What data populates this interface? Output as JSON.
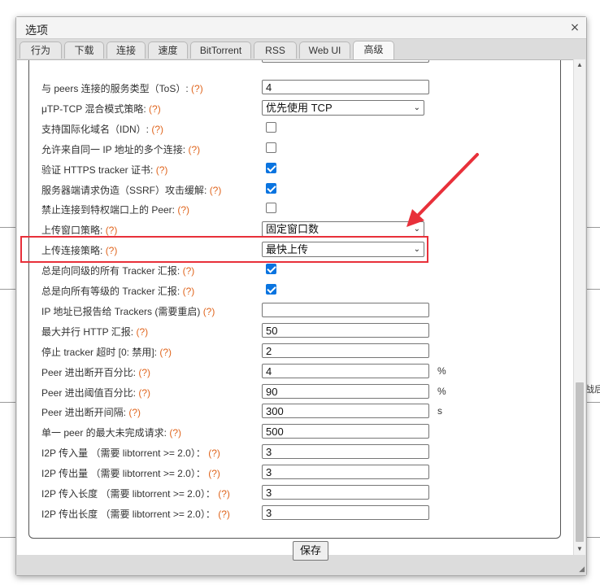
{
  "dialog": {
    "title": "选项",
    "close_label": "×"
  },
  "tabs": [
    {
      "label": "行为"
    },
    {
      "label": "下载"
    },
    {
      "label": "连接"
    },
    {
      "label": "速度"
    },
    {
      "label": "BitTorrent"
    },
    {
      "label": "RSS"
    },
    {
      "label": "Web UI"
    },
    {
      "label": "高级"
    }
  ],
  "active_tab": "高级",
  "rows": [
    {
      "label": "与 peers 连接的服务类型（ToS）:",
      "help": "(?)",
      "type": "text",
      "value": "4"
    },
    {
      "label": "μTP-TCP 混合模式策略:",
      "help": "(?)",
      "type": "select",
      "value": "优先使用 TCP"
    },
    {
      "label": "支持国际化域名（IDN）:",
      "help": "(?)",
      "type": "checkbox",
      "checked": false
    },
    {
      "label": "允许来自同一 IP 地址的多个连接:",
      "help": "(?)",
      "type": "checkbox",
      "checked": false
    },
    {
      "label": "验证 HTTPS tracker 证书:",
      "help": "(?)",
      "type": "checkbox",
      "checked": true
    },
    {
      "label": "服务器端请求伪造（SSRF）攻击缓解:",
      "help": "(?)",
      "type": "checkbox",
      "checked": true
    },
    {
      "label": "禁止连接到特权端口上的 Peer:",
      "help": "(?)",
      "type": "checkbox",
      "checked": false
    },
    {
      "label": "上传窗口策略:",
      "help": "(?)",
      "type": "select",
      "value": "固定窗口数"
    },
    {
      "label": "上传连接策略:",
      "help": "(?)",
      "type": "select",
      "value": "最快上传"
    },
    {
      "label": "总是向同级的所有 Tracker 汇报:",
      "help": "(?)",
      "type": "checkbox",
      "checked": true
    },
    {
      "label": "总是向所有等级的 Tracker 汇报:",
      "help": "(?)",
      "type": "checkbox",
      "checked": true
    },
    {
      "label": "IP 地址已报告给 Trackers (需要重启)",
      "help": "(?)",
      "type": "text",
      "value": ""
    },
    {
      "label": "最大并行 HTTP 汇报:",
      "help": "(?)",
      "type": "text",
      "value": "50"
    },
    {
      "label": "停止 tracker 超时 [0: 禁用]:",
      "help": "(?)",
      "type": "text",
      "value": "2"
    },
    {
      "label": "Peer 进出断开百分比:",
      "help": "(?)",
      "type": "text",
      "value": "4",
      "unit": "%"
    },
    {
      "label": "Peer 进出阈值百分比:",
      "help": "(?)",
      "type": "text",
      "value": "90",
      "unit": "%"
    },
    {
      "label": "Peer 进出断开间隔:",
      "help": "(?)",
      "type": "text",
      "value": "300",
      "unit": "s"
    },
    {
      "label": "单一 peer 的最大未完成请求:",
      "help": "(?)",
      "type": "text",
      "value": "500"
    },
    {
      "label": "I2P 传入量 （需要 libtorrent >= 2.0）：",
      "help": "(?)",
      "type": "text",
      "value": "3"
    },
    {
      "label": "I2P 传出量 （需要 libtorrent >= 2.0）：",
      "help": "(?)",
      "type": "text",
      "value": "3"
    },
    {
      "label": "I2P 传入长度 （需要 libtorrent >= 2.0）：",
      "help": "(?)",
      "type": "text",
      "value": "3"
    },
    {
      "label": "I2P 传出长度 （需要 libtorrent >= 2.0）：",
      "help": "(?)",
      "type": "text",
      "value": "3"
    }
  ],
  "footer": {
    "save_label": "保存"
  },
  "background_text": "战后多",
  "colors": {
    "highlight": "#e8303a",
    "help": "#e0661f",
    "checkbox_checked": "#0a74e0"
  }
}
